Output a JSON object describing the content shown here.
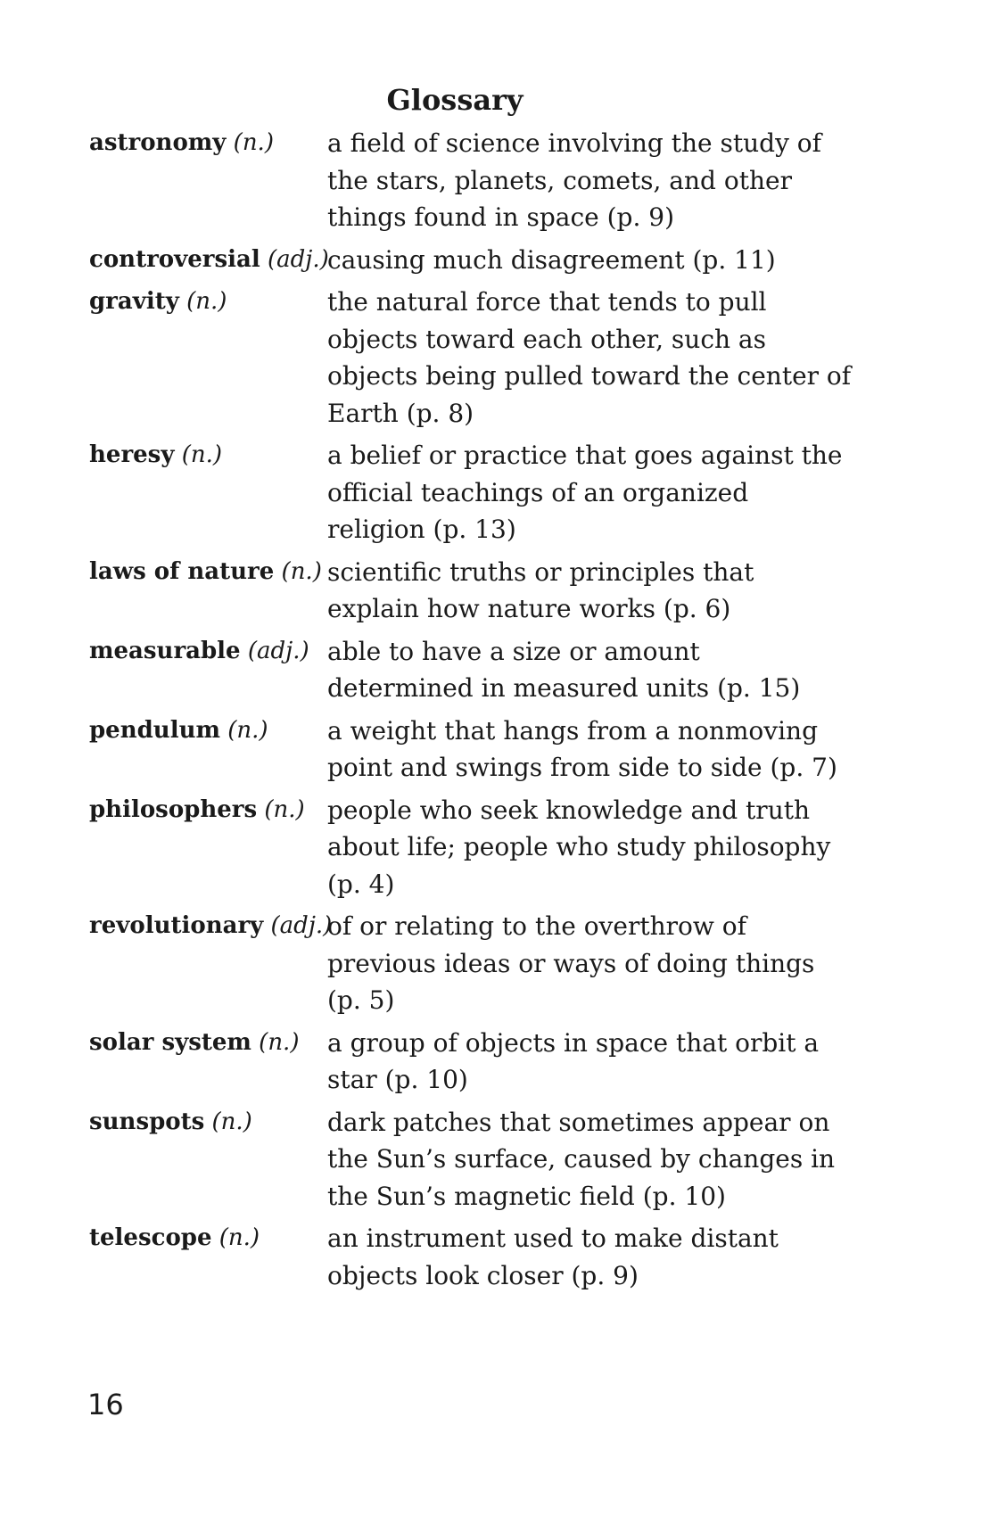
{
  "title": "Glossary",
  "entries": [
    {
      "term": "astronomy",
      "pos": "(n.)",
      "definition": "a field of science involving the study of the stars, planets, comets, and other things found in space (p. 9)"
    },
    {
      "term": "controversial",
      "pos": "(adj.)",
      "definition": "causing much disagreement (p. 11)"
    },
    {
      "term": "gravity",
      "pos": "(n.)",
      "definition": "the natural force that tends to pull objects toward each other, such as objects being pulled toward the center of Earth (p. 8)"
    },
    {
      "term": "heresy",
      "pos": "(n.)",
      "definition": "a belief or practice that goes against the official teachings of an organized religion (p. 13)"
    },
    {
      "term": "laws of nature",
      "pos": "(n.)",
      "definition": "scientific truths or principles that explain how nature works (p. 6)"
    },
    {
      "term": "measurable",
      "pos": "(adj.)",
      "definition": "able to have a size or amount determined in measured units (p. 15)"
    },
    {
      "term": "pendulum",
      "pos": "(n.)",
      "definition": "a weight that hangs from a nonmoving point and swings from side to side (p. 7)"
    },
    {
      "term": "philosophers",
      "pos": "(n.)",
      "definition": "people who seek knowledge and truth about life; people who study philosophy (p. 4)"
    },
    {
      "term": "revolutionary",
      "pos": "(adj.)",
      "definition": "of or relating to the overthrow of previous ideas or ways of doing things (p. 5)"
    },
    {
      "term": "solar system",
      "pos": "(n.)",
      "definition": "a group of objects in space that orbit a star (p. 10)"
    },
    {
      "term": "sunspots",
      "pos": "(n.)",
      "definition": "dark patches that sometimes appear on the Sun’s surface, caused by changes in the Sun’s magnetic field (p. 10)"
    },
    {
      "term": "telescope",
      "pos": "(n.)",
      "definition": "an instrument used to make distant objects look closer (p. 9)"
    }
  ],
  "page_number": "16"
}
